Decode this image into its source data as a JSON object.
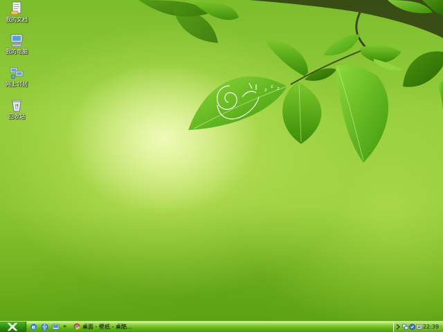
{
  "desktop": {
    "icons": [
      {
        "label": "我的文档",
        "icon": "my-documents-icon"
      },
      {
        "label": "我的电脑",
        "icon": "my-computer-icon"
      },
      {
        "label": "网上邻居",
        "icon": "network-places-icon"
      },
      {
        "label": "回收站",
        "icon": "recycle-bin-icon"
      }
    ]
  },
  "taskbar": {
    "start_icon": "start-logo-icon",
    "quick_launch": [
      "internet-explorer-icon",
      "browser-icon",
      "show-desktop-icon"
    ],
    "more_chevron": "»",
    "task_item": {
      "label": "桌面 - 壁纸 - 桌酷...",
      "icon": "chrome-icon"
    },
    "tray": {
      "icons": [
        "tray-arrow-icon",
        "network-icon",
        "security-icon",
        "input-method-icon"
      ],
      "clock": "22:39"
    }
  },
  "colors": {
    "taskbar": "#5fb414",
    "start_button": "#2e8a10",
    "leaf": "#5cad1c"
  }
}
